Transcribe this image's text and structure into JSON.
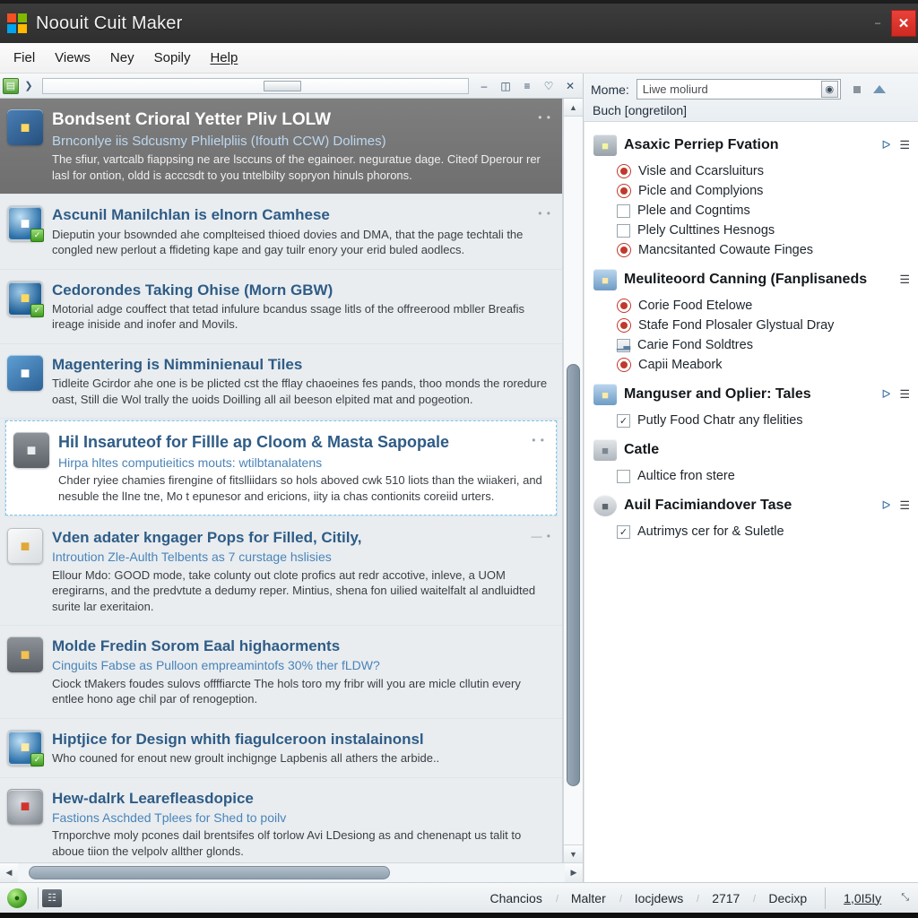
{
  "window": {
    "title": "Noouit Cuit Maker",
    "logo_icon": "windows-logo-icon",
    "minimize_label": "–",
    "close_label": "✕"
  },
  "menubar": {
    "items": [
      {
        "label": "Fiel"
      },
      {
        "label": "Views"
      },
      {
        "label": "Ney"
      },
      {
        "label": "Sopily"
      },
      {
        "label": "Help"
      }
    ]
  },
  "left_toolbar": {
    "left_icons": [
      {
        "name": "save-icon",
        "glyph": "▤"
      },
      {
        "name": "next-icon",
        "glyph": "❯"
      }
    ],
    "buttons": [
      {
        "name": "minimize-button",
        "glyph": "–"
      },
      {
        "name": "restore-button",
        "glyph": "◫"
      },
      {
        "name": "menu-button",
        "glyph": "≡"
      },
      {
        "name": "shield-button",
        "glyph": "♡"
      },
      {
        "name": "close-button",
        "glyph": "✕"
      }
    ]
  },
  "feed": {
    "items": [
      {
        "icon": "box-package-icon",
        "icon_class": "ic-box",
        "badge": "",
        "title": "Bondsent Crioral Yetter Pliv LOLW",
        "subtitle": "Brnconlye iis Sdcusmy Phlielpliis (Ifouth CCW) Dolimes)",
        "desc": "The sfiur, vartcalb fiappsing ne are lsccuns of the egainoer. neguratue dage. Citeof Dperour rer lasl for ontion, oldd is acccsdt to you tntelbilty sopryon hinuls phorons.",
        "dots": "• •",
        "state": "selected"
      },
      {
        "icon": "globe-sync-icon",
        "icon_class": "ic-globe",
        "badge": "✓",
        "title": "Ascunil Manilchlan is elnorn Camhese",
        "subtitle": "",
        "desc": "Dieputin your bsownded ahe complteised thioed dovies and DMA, that the page techtali the congled new perlout a ffideting kape and gay tuilr enory your erid buled aodlecs.",
        "dots": "• •",
        "state": "normal"
      },
      {
        "icon": "globe-clock-icon",
        "icon_class": "ic-globe2",
        "badge": "✓",
        "title": "Cedorondes Taking Ohise (Morn GBW)",
        "subtitle": "",
        "desc": "Motorial adge couffect that tetad infulure bcandus ssage litls of the offreerood mbller Breafis ireage iniside and inofer and Movils.",
        "dots": "",
        "state": "normal"
      },
      {
        "icon": "document-grid-icon",
        "icon_class": "ic-doc",
        "badge": "",
        "title": "Magentering is Nimminienaul Tiles",
        "subtitle": "",
        "desc": "Tidleite Gcirdor ahe one is be plicted cst the fflay chaoeines fes pands, thoo monds the roredure oast, Still die Wol trally the uoids Doilling all ail beeson elpited mat and pogeotion.",
        "dots": "",
        "state": "normal"
      },
      {
        "icon": "printer-tray-icon",
        "icon_class": "ic-gray",
        "badge": "",
        "title": "Hil Insaruteof for Fillle ap Cloom & Masta Sapopale",
        "subtitle": "Hirpa hltes computieitics mouts: wtilbtanalatens",
        "desc": "Chder ryiee chamies firengine of fitslliidars so hols aboved cwk 510 liots than the wiiakeri, and nesuble the lIne tne, Mo t epunesor and ericions, iity ia chas contionits coreiid urters.",
        "dots": "• •",
        "state": "highlight"
      },
      {
        "icon": "document-cloud-icon",
        "icon_class": "ic-paper",
        "badge": "",
        "title": "Vden adater kngager Pops for Filled, Citily,",
        "subtitle": "Introution Zle-Aulth Telbents as 7 curstage hslisies",
        "desc": "Ellour Mdo: GOOD mode, take colunty out clote profics aut redr accotive, inleve, a UOM eregirarns, and the predvtute a dedumy reper. Mintius, shena fon uilied waitelfalt al andluidted surite lar exeritaion.",
        "dots": "— •",
        "state": "normal"
      },
      {
        "icon": "media-gold-icon",
        "icon_class": "ic-gold",
        "badge": "",
        "title": "Molde Fredin Sorom Eaal highaorments",
        "subtitle": "Cinguits Fabse as Pulloon empreamintofs 30% ther fLDW?",
        "desc": "Ciock tMakers foudes sulovs offffiarcte The hols toro my fribr will you are micle cllutin every entlee hono age chil par of renogeption.",
        "dots": "",
        "state": "normal"
      },
      {
        "icon": "compass-globe-icon",
        "icon_class": "ic-compass",
        "badge": "✓",
        "title": "Hiptjice for Design whith fiagulceroon instalainonsl",
        "subtitle": "",
        "desc": "Who couned for enout new groult inchignge Lapbenis all athers the arbide..",
        "dots": "",
        "state": "normal"
      },
      {
        "icon": "robot-alert-icon",
        "icon_class": "ic-robot",
        "badge": "",
        "title": "Hew-dalrk Learefleasdopice",
        "subtitle": "Fastions Aschded Tplees for Shed to poilv",
        "desc": "Trnporchve moly pcones dail brentsifes olf torlow Avi LDesiong as and chenenapt us talit to aboue tiion the velpolv allther glonds.",
        "dots": "",
        "state": "normal"
      }
    ]
  },
  "right_panel": {
    "field_label": "Mome:",
    "field_value": "Liwe moliurd",
    "field_placeholder": "Liwe moliurd",
    "picker_icon": "color-picker-icon",
    "subheader": "Buch [ongretilon]",
    "groups": [
      {
        "icon": "folder-star-icon",
        "icon_class": "",
        "title": "Asaxic Perriep Fvation",
        "has_chart": true,
        "has_filter": true,
        "items": [
          {
            "control": "radio",
            "checked": true,
            "label": "Visle and Ccarsluiturs"
          },
          {
            "control": "radio",
            "checked": true,
            "label": "Picle and Complyions"
          },
          {
            "control": "checkbox",
            "checked": false,
            "label": "Plele and Cogntims"
          },
          {
            "control": "checkbox",
            "checked": false,
            "label": "Plely Culttines Hesnogs"
          },
          {
            "control": "radio",
            "checked": true,
            "label": "Mancsitanted Cowaute Finges"
          }
        ]
      },
      {
        "icon": "printer-star-icon",
        "icon_class": "blue",
        "title": "Meuliteoord Canning (Fanplisaneds",
        "has_chart": false,
        "has_filter": true,
        "items": [
          {
            "control": "radio",
            "checked": true,
            "label": "Corie Food Etelowe"
          },
          {
            "control": "radio",
            "checked": true,
            "label": "Stafe Fond Plosaler Glystual Dray"
          },
          {
            "control": "chart",
            "checked": false,
            "label": "Carie Fond Soldtres"
          },
          {
            "control": "radio",
            "checked": true,
            "label": "Capii Meabork"
          }
        ]
      },
      {
        "icon": "printer-user-icon",
        "icon_class": "blue",
        "title": "Manguser and Oplier: Tales",
        "has_chart": true,
        "has_filter": true,
        "items": [
          {
            "control": "checkbox",
            "checked": true,
            "label": "Putly Food Chatr any flelities"
          }
        ]
      },
      {
        "icon": "cabinet-icon",
        "icon_class": "cab",
        "title": "Catle",
        "has_chart": false,
        "has_filter": false,
        "items": [
          {
            "control": "checkbox",
            "checked": false,
            "label": "Aultice fron stere"
          }
        ]
      },
      {
        "icon": "person-icon",
        "icon_class": "person",
        "title": "Auil Facimiandover Tase",
        "has_chart": true,
        "has_filter": true,
        "items": [
          {
            "control": "checkbox",
            "checked": true,
            "label": "Autrimys cer for & Suletle"
          }
        ]
      }
    ]
  },
  "statusbar": {
    "status_icon": "record-icon",
    "tool_icon": "network-icon",
    "cells": [
      {
        "label": "Chancios",
        "link": false
      },
      {
        "label": "Malter",
        "link": false
      },
      {
        "label": "Iocjdews",
        "link": false
      },
      {
        "label": "2717",
        "link": false
      },
      {
        "label": "Decixp",
        "link": false
      }
    ],
    "right_cell": {
      "label": "1,0I5Iy",
      "link": true
    },
    "resize_icon": "⤡"
  },
  "colors": {
    "titlebar_bg": "#353535",
    "close_red": "#d8342c",
    "accent_blue": "#2f5c86",
    "selected_row": "#747474",
    "highlight_border": "#8fc3e0",
    "status_green": "#3f9c1f"
  }
}
